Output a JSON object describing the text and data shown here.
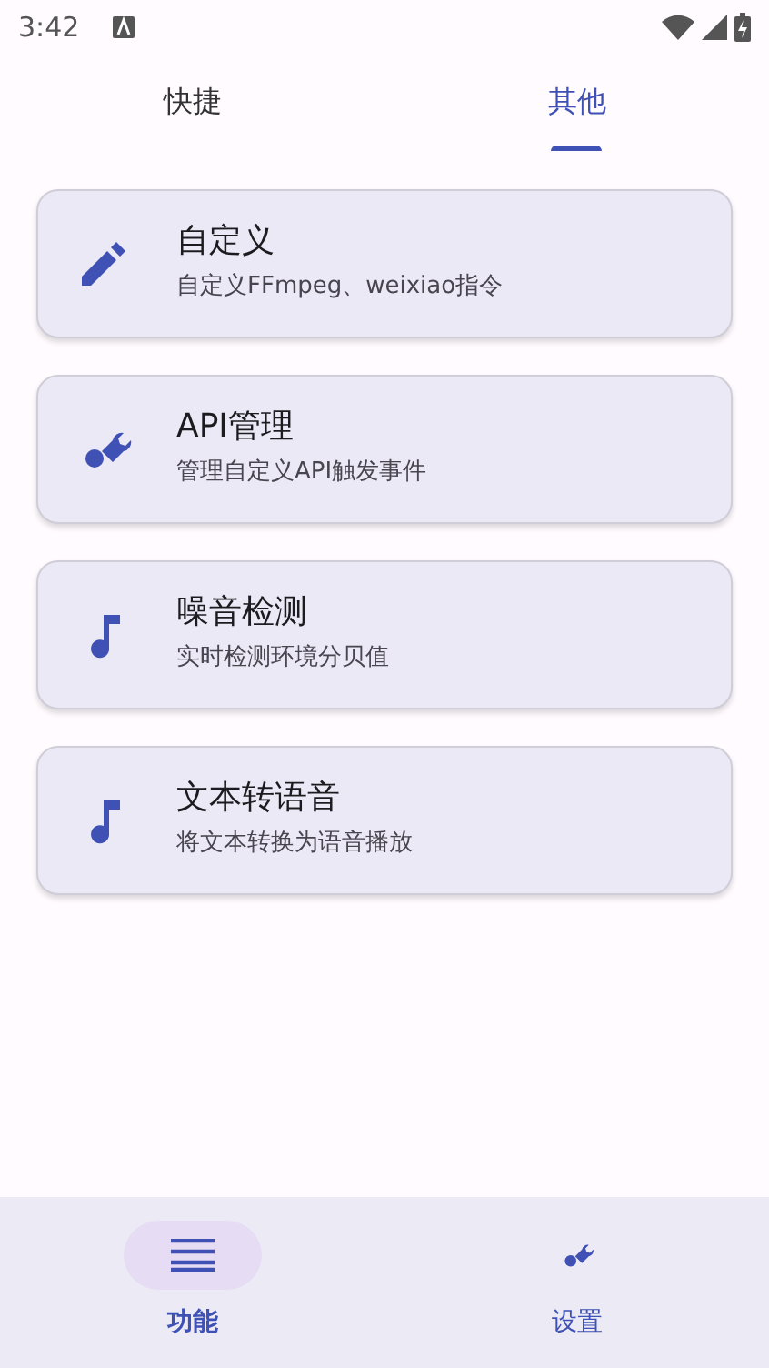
{
  "status_bar": {
    "time": "3:42"
  },
  "tabs": [
    {
      "label": "快捷",
      "selected": false
    },
    {
      "label": "其他",
      "selected": true
    }
  ],
  "cards": [
    {
      "title": "自定义",
      "subtitle": "自定义FFmpeg、weixiao指令"
    },
    {
      "title": "API管理",
      "subtitle": "管理自定义API触发事件"
    },
    {
      "title": "噪音检测",
      "subtitle": "实时检测环境分贝值"
    },
    {
      "title": "文本转语音",
      "subtitle": "将文本转换为语音播放"
    }
  ],
  "bottom_nav": [
    {
      "label": "功能",
      "selected": true
    },
    {
      "label": "设置",
      "selected": false
    }
  ]
}
